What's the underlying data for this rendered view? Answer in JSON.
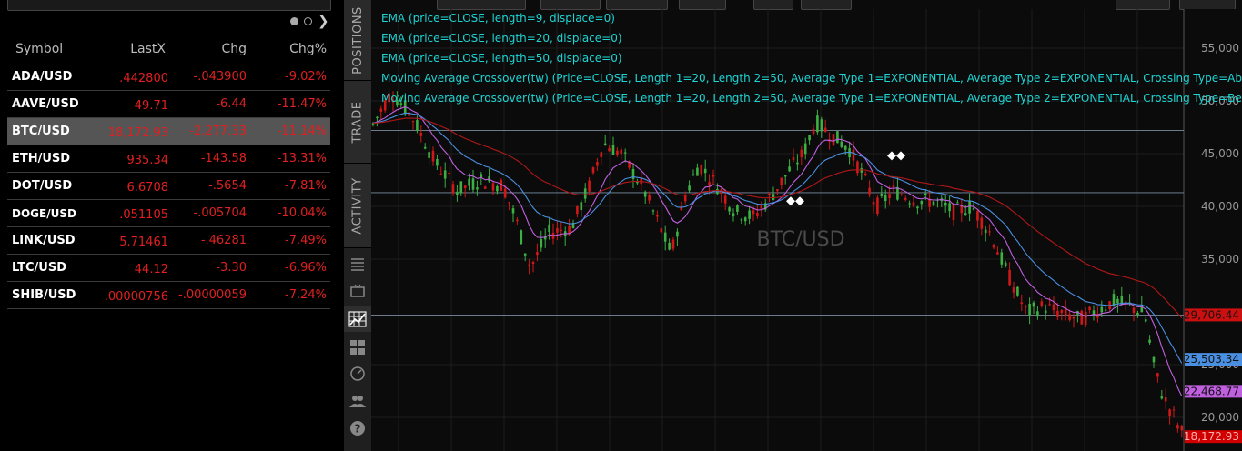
{
  "watchlist": {
    "columns": [
      "Symbol",
      "LastX",
      "Chg",
      "Chg%"
    ],
    "rows": [
      {
        "symbol": "ADA/USD",
        "last": ".442800",
        "chg": "-.043900",
        "pct": "-9.02%"
      },
      {
        "symbol": "AAVE/USD",
        "last": "49.71",
        "chg": "-6.44",
        "pct": "-11.47%"
      },
      {
        "symbol": "BTC/USD",
        "last": "18,172.93",
        "chg": "-2,277.33",
        "pct": "-11.14%"
      },
      {
        "symbol": "ETH/USD",
        "last": "935.34",
        "chg": "-143.58",
        "pct": "-13.31%"
      },
      {
        "symbol": "DOT/USD",
        "last": "6.6708",
        "chg": "-.5654",
        "pct": "-7.81%"
      },
      {
        "symbol": "DOGE/USD",
        "last": ".051105",
        "chg": "-.005704",
        "pct": "-10.04%"
      },
      {
        "symbol": "LINK/USD",
        "last": "5.71461",
        "chg": "-.46281",
        "pct": "-7.49%"
      },
      {
        "symbol": "LTC/USD",
        "last": "44.12",
        "chg": "-3.30",
        "pct": "-6.96%"
      },
      {
        "symbol": "SHIB/USD",
        "last": ".00000756",
        "chg": "-.00000059",
        "pct": "-7.24%"
      }
    ],
    "selected_index": 2,
    "icons": {
      "pager_next": "chevron-right-icon"
    }
  },
  "tabs": {
    "positions": "POSITIONS",
    "trade": "TRADE",
    "activity": "ACTIVITY"
  },
  "chart": {
    "watermark": "BTC/USD",
    "studies": [
      "EMA (price=CLOSE, length=9, displace=0)",
      "EMA (price=CLOSE, length=20, displace=0)",
      "EMA (price=CLOSE, length=50, displace=0)",
      "Moving Average Crossover(tw) (Price=CLOSE, Length 1=20, Length 2=50, Average Type 1=EXPONENTIAL, Average Type 2=EXPONENTIAL, Crossing Type=Ab",
      "Moving Average Crossover(tw) (Price=CLOSE, Length 1=20, Length 2=50, Average Type 1=EXPONENTIAL, Average Type 2=EXPONENTIAL, Crossing Type=Be"
    ],
    "y_ticks": [
      "55,000",
      "50,000",
      "45,000",
      "40,000",
      "35,000",
      "25,000",
      "20,000"
    ],
    "y_tick_values": [
      55000,
      50000,
      45000,
      40000,
      35000,
      25000,
      20000
    ],
    "price_tags": [
      {
        "label": "29,706.44",
        "value": 29706.44,
        "color": "#cc1010",
        "text": "#111"
      },
      {
        "label": "25,503.34",
        "value": 25503.34,
        "color": "#4a90e2",
        "text": "#111"
      },
      {
        "label": "22,468.77",
        "value": 22468.77,
        "color": "#c060e0",
        "text": "#111"
      },
      {
        "label": "18,172.93",
        "value": 18172.93,
        "color": "#d00000",
        "text": "#ffb0b0"
      }
    ],
    "horizontal_lines": [
      47200,
      41300,
      29700
    ],
    "colors": {
      "up": "#3cb043",
      "down": "#d01818",
      "ema9": "#c060e0",
      "ema20": "#4a90e2",
      "ema50": "#b01818",
      "study_text": "#1fd4d4"
    }
  }
}
